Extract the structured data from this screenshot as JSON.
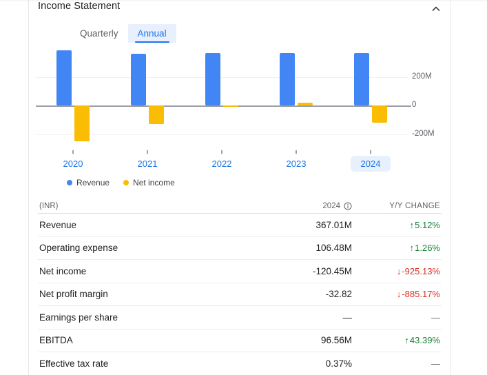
{
  "card": {
    "title": "Income Statement",
    "collapse_icon": "chevron-up-icon"
  },
  "tabs": [
    {
      "label": "Quarterly",
      "selected": false
    },
    {
      "label": "Annual",
      "selected": true
    }
  ],
  "legend": [
    {
      "label": "Revenue",
      "color": "#4285f4"
    },
    {
      "label": "Net income",
      "color": "#fbbc04"
    }
  ],
  "chart_data": {
    "type": "bar",
    "title": "Income Statement",
    "xlabel": "",
    "ylabel": "",
    "categories": [
      "2020",
      "2021",
      "2022",
      "2023",
      "2024"
    ],
    "selected_category": "2024",
    "series": [
      {
        "name": "Revenue",
        "color": "#4285f4",
        "values": [
          385,
          360,
          365,
          365,
          367.01
        ]
      },
      {
        "name": "Net income",
        "color": "#fbbc04",
        "values": [
          -250,
          -130,
          -8,
          18,
          -120.45
        ]
      }
    ],
    "yticks": [
      "200M",
      "0",
      "-200M"
    ],
    "ylim": [
      -280,
      420
    ],
    "grid": true,
    "legend_position": "bottom-left",
    "units": "INR"
  },
  "table": {
    "headers": {
      "label": "(INR)",
      "value": "2024",
      "value_info_icon": "info-icon",
      "change": "Y/Y CHANGE"
    },
    "rows": [
      {
        "label": "Revenue",
        "value": "367.01M",
        "change": "5.12%",
        "arrow": "↑",
        "direction": "up"
      },
      {
        "label": "Operating expense",
        "value": "106.48M",
        "change": "1.26%",
        "arrow": "↑",
        "direction": "up"
      },
      {
        "label": "Net income",
        "value": "-120.45M",
        "change": "-925.13%",
        "arrow": "↓",
        "direction": "down"
      },
      {
        "label": "Net profit margin",
        "value": "-32.82",
        "change": "-885.17%",
        "arrow": "↓",
        "direction": "down"
      },
      {
        "label": "Earnings per share",
        "value": "—",
        "change": "—",
        "arrow": "",
        "direction": "none"
      },
      {
        "label": "EBITDA",
        "value": "96.56M",
        "change": "43.39%",
        "arrow": "↑",
        "direction": "up"
      },
      {
        "label": "Effective tax rate",
        "value": "0.37%",
        "change": "—",
        "arrow": "",
        "direction": "none"
      }
    ]
  }
}
